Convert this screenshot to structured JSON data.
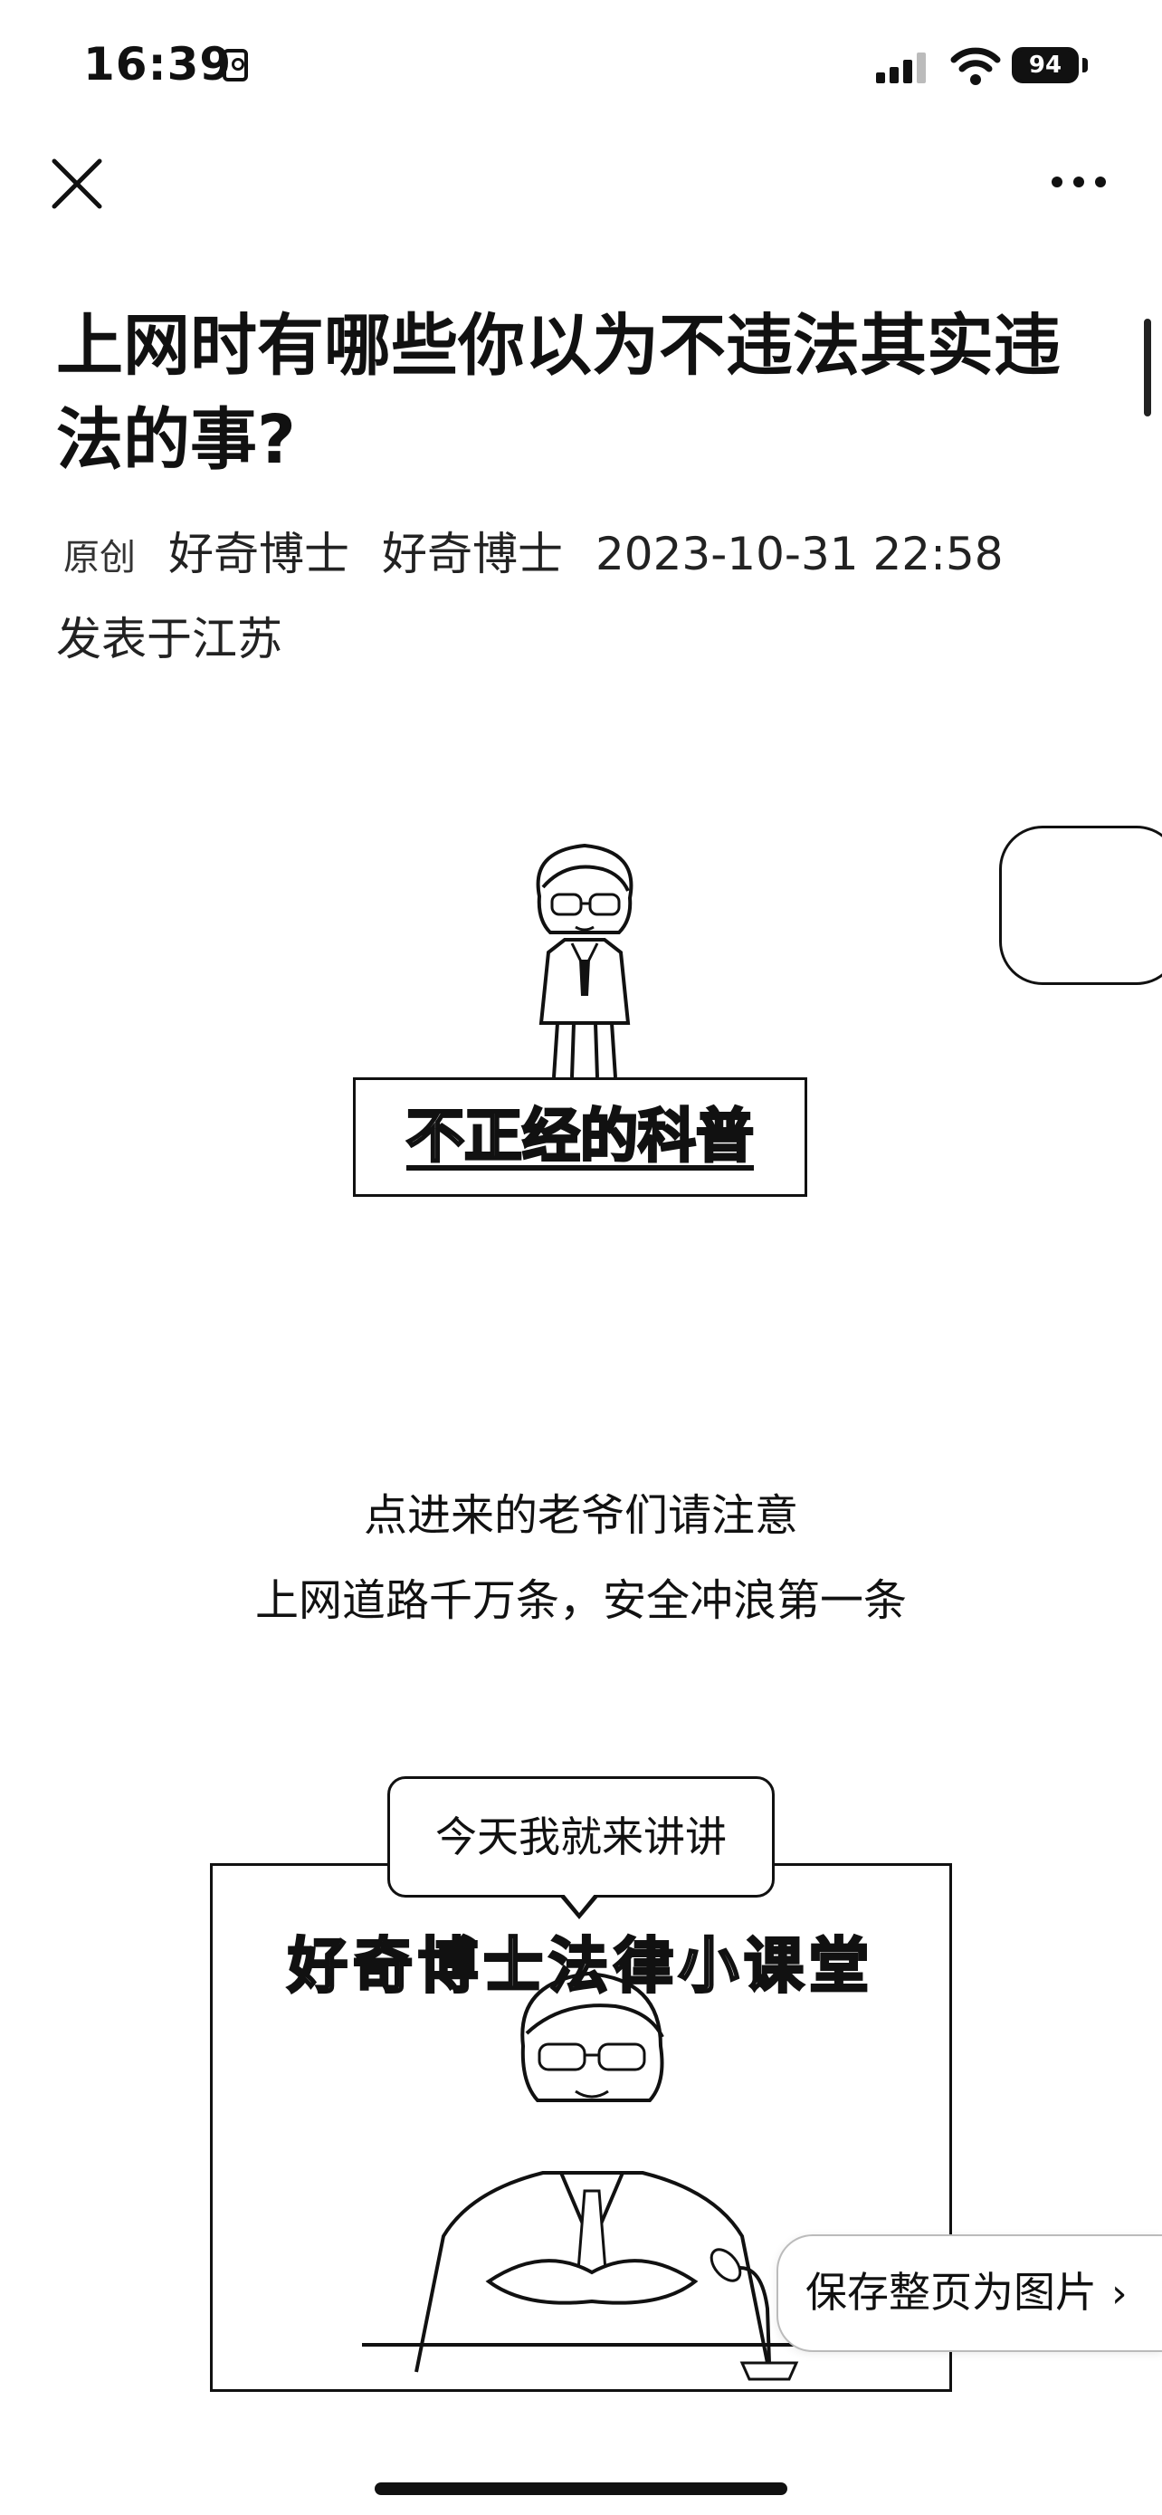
{
  "status_bar": {
    "time": "16:39",
    "battery": "94"
  },
  "article": {
    "title": "上网时有哪些你以为不违法其实违法的事?",
    "original_tag": "原创",
    "author": "好奇博士",
    "account": "好奇博士",
    "datetime": "2023-10-31 22:58",
    "location": "发表于江苏"
  },
  "banner": {
    "text": "不正经的科普"
  },
  "intro": {
    "line1": "点进来的老爷们请注意",
    "line2": "上网道路千万条，安全冲浪第一条"
  },
  "comic": {
    "bubble": "今天我就来讲讲",
    "heading": "好奇博士法律小课堂"
  },
  "save_button": {
    "label": "保存整页为图片",
    "chevron": "›"
  },
  "icons": {
    "close": "close-icon",
    "more": "more-icon"
  }
}
